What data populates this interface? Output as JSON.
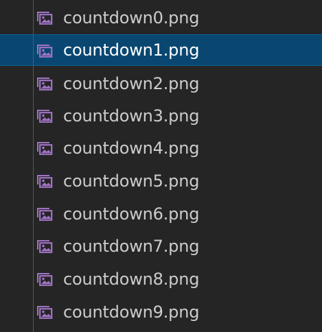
{
  "explorer": {
    "items": [
      {
        "label": "countdown0.png",
        "icon": "image-file-icon",
        "selected": false
      },
      {
        "label": "countdown1.png",
        "icon": "image-file-icon",
        "selected": true
      },
      {
        "label": "countdown2.png",
        "icon": "image-file-icon",
        "selected": false
      },
      {
        "label": "countdown3.png",
        "icon": "image-file-icon",
        "selected": false
      },
      {
        "label": "countdown4.png",
        "icon": "image-file-icon",
        "selected": false
      },
      {
        "label": "countdown5.png",
        "icon": "image-file-icon",
        "selected": false
      },
      {
        "label": "countdown6.png",
        "icon": "image-file-icon",
        "selected": false
      },
      {
        "label": "countdown7.png",
        "icon": "image-file-icon",
        "selected": false
      },
      {
        "label": "countdown8.png",
        "icon": "image-file-icon",
        "selected": false
      },
      {
        "label": "countdown9.png",
        "icon": "image-file-icon",
        "selected": false
      }
    ]
  },
  "colors": {
    "background": "#252526",
    "selected_background": "#094771",
    "text": "#cccccc",
    "selected_text": "#ffffff",
    "icon": "#a074c4"
  }
}
